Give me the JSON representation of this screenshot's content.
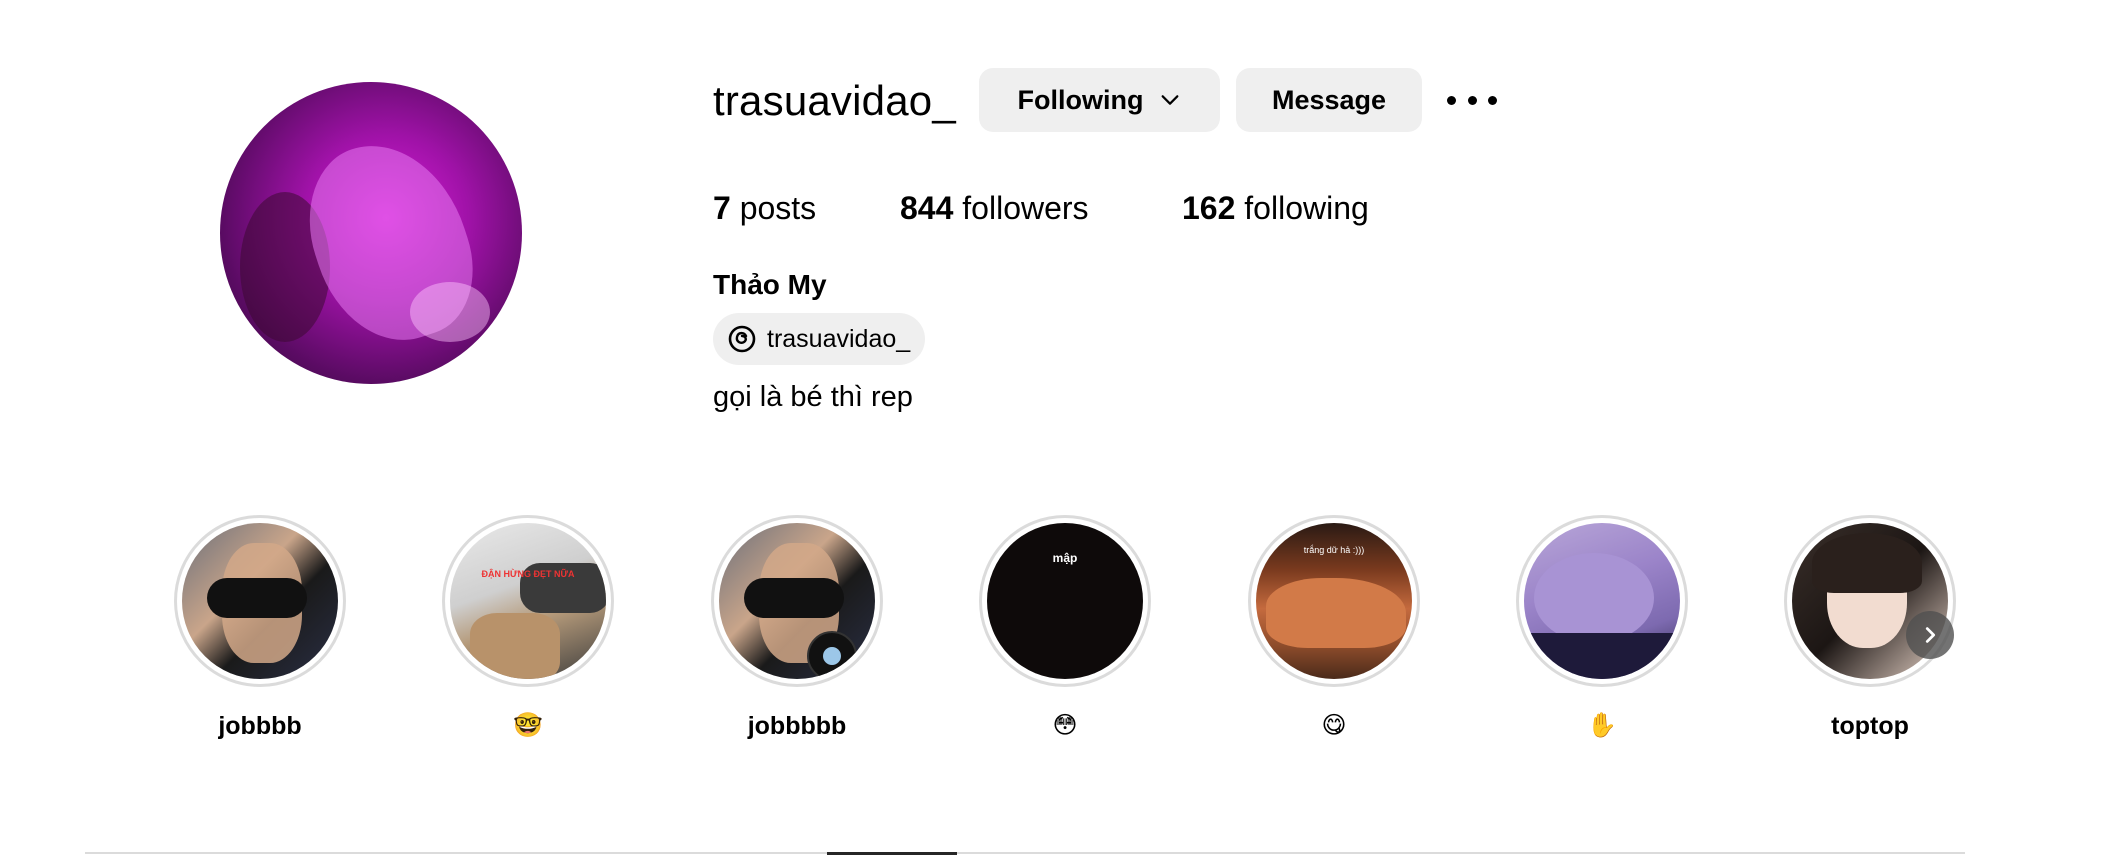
{
  "profile": {
    "username": "trasuavidao_",
    "following_button": "Following",
    "message_button": "Message",
    "stats": {
      "posts_count": "7",
      "posts_label": "posts",
      "followers_count": "844",
      "followers_label": "followers",
      "following_count": "162",
      "following_label": "following"
    },
    "full_name": "Thảo My",
    "threads_handle": "trasuavidao_",
    "bio": "gọi là bé thì rep"
  },
  "highlights": [
    {
      "label": "jobbbb",
      "emoji": false
    },
    {
      "label": "🤓",
      "emoji": true
    },
    {
      "label": "jobbbbb",
      "emoji": false,
      "badge_icon": "music-disc-icon"
    },
    {
      "label": "😳",
      "emoji": true,
      "cover_text": "mập"
    },
    {
      "label": "😋",
      "emoji": true,
      "cover_text": "trắng dữ hả :)))"
    },
    {
      "label": "✋",
      "emoji": true
    },
    {
      "label": "toptop",
      "emoji": false
    }
  ],
  "highlight_2_overlay": "ĐẬN HỪNG ĐẸT NỮA",
  "colors": {
    "button_bg": "#efefef",
    "ring": "#dbdbdb",
    "text": "#000000"
  }
}
